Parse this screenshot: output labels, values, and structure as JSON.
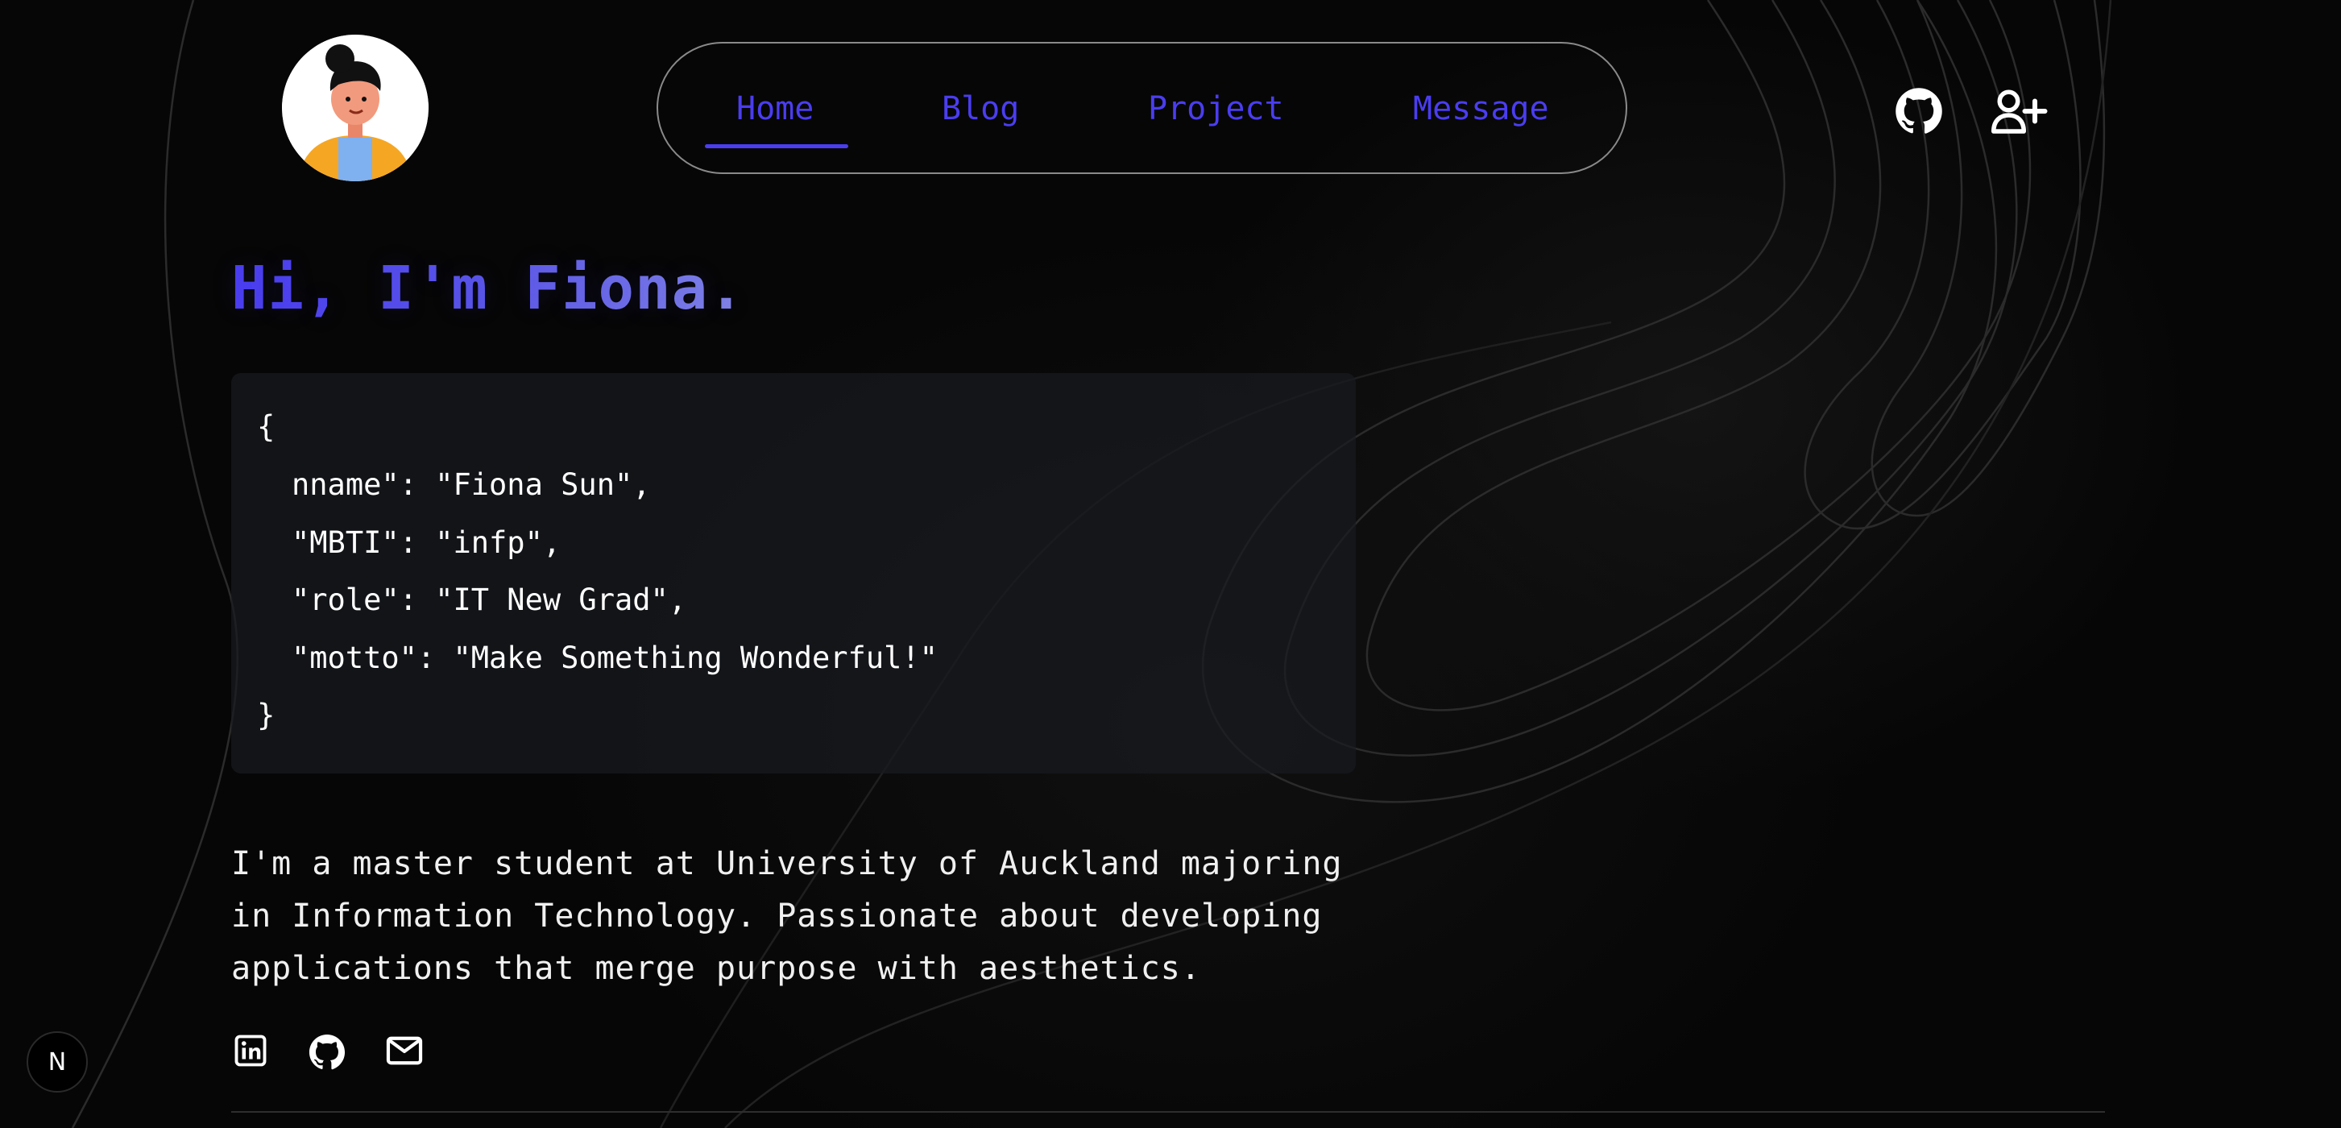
{
  "nav": {
    "items": [
      {
        "label": "Home"
      },
      {
        "label": "Blog"
      },
      {
        "label": "Project"
      },
      {
        "label": "Message"
      }
    ],
    "accent": "#4a3df0"
  },
  "header": {
    "avatar_icon": "cartoon-avatar",
    "github_icon": "github-icon",
    "add_user_icon": "user-plus-icon"
  },
  "hero": {
    "title": "Hi, I'm Fiona."
  },
  "code_block": {
    "open": "{",
    "lines": [
      "nname\": \"Fiona Sun\",",
      "\"MBTI\": \"infp\",",
      "\"role\": \"IT New Grad\",",
      "\"motto\": \"Make Something Wonderful!\""
    ],
    "close": "}"
  },
  "bio": {
    "text": "I'm a master student at University of Auckland majoring in Information Technology. Passionate about developing applications that merge purpose with aesthetics."
  },
  "social": {
    "icons": [
      "linkedin-icon",
      "github-icon",
      "mail-icon"
    ]
  },
  "badge": {
    "label": "N"
  }
}
